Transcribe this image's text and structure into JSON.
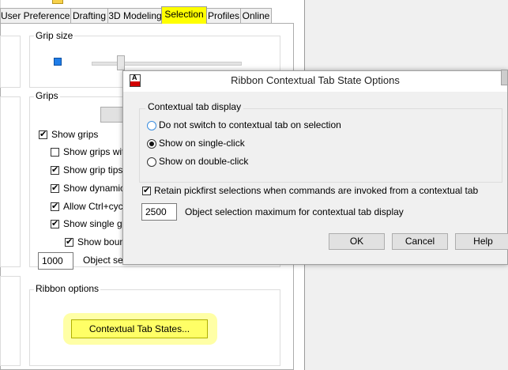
{
  "options": {
    "tabs": [
      {
        "label": "User Preferences",
        "active": false
      },
      {
        "label": "Drafting",
        "active": false
      },
      {
        "label": "3D Modeling",
        "active": false
      },
      {
        "label": "Selection",
        "active": true
      },
      {
        "label": "Profiles",
        "active": false
      },
      {
        "label": "Online",
        "active": false
      }
    ],
    "grip_size_label": "Grip size",
    "grip_size_level": 0.18,
    "grips_label": "Grips",
    "grip_checks": [
      {
        "label": "Show grips",
        "checked": true
      },
      {
        "label": "Show grips with",
        "checked": false
      },
      {
        "label": "Show grip tips",
        "checked": true
      },
      {
        "label": "Show dynamic g",
        "checked": true
      },
      {
        "label": "Allow Ctrl+cyclin",
        "checked": true
      },
      {
        "label": "Show single grip",
        "checked": true
      },
      {
        "label": "Show bound",
        "checked": true
      }
    ],
    "object_select_value": "1000",
    "object_select_label": "Object sel",
    "ribbon_label": "Ribbon options",
    "ribbon_button": "Contextual Tab States..."
  },
  "dialog": {
    "title": "Ribbon Contextual Tab State Options",
    "icon": "autocad-app-icon",
    "group_label": "Contextual tab display",
    "radios": [
      {
        "label": "Do not switch to contextual tab on selection",
        "selected": false
      },
      {
        "label": "Show on single-click",
        "selected": true
      },
      {
        "label": "Show on double-click",
        "selected": false
      }
    ],
    "retain_label": "Retain pickfirst selections when commands are invoked from a contextual tab",
    "retain_checked": true,
    "max_value": "2500",
    "max_label": "Object selection maximum for contextual tab display",
    "buttons": {
      "ok": "OK",
      "cancel": "Cancel",
      "help": "Help"
    }
  },
  "colors": {
    "highlight": "#ffff00",
    "accent": "#3b8ee0",
    "icon_red": "#d20000"
  }
}
